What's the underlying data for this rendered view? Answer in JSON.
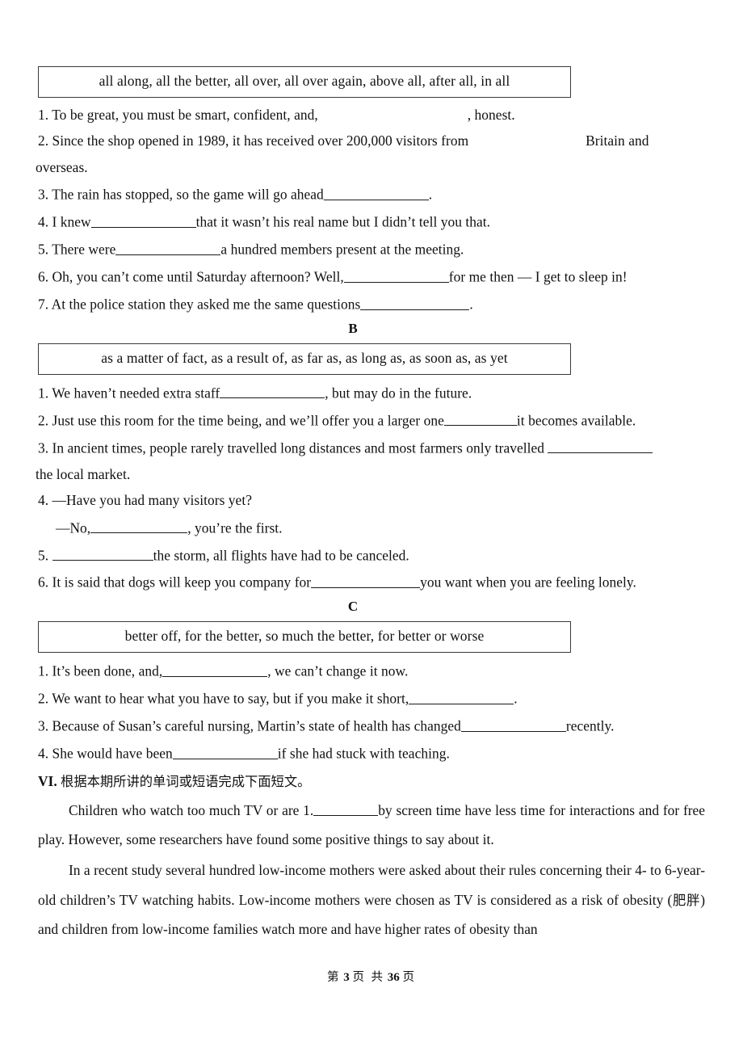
{
  "document": {
    "footer": {
      "prefix": "第",
      "page_number": "3",
      "middle": "页 共",
      "total_pages": "36",
      "suffix": "页"
    }
  },
  "sections": {
    "a": {
      "wordbank": "all along, all the better, all over, all over again, above all, after all, in all",
      "items": {
        "i1_pre": "1. To be great, you must be smart, confident, and,",
        "i1_post": ", honest.",
        "i2_pre": "2. Since the shop opened in 1989, it has received over 200,000 visitors from",
        "i2_post": "Britain and",
        "i2_cont": "overseas.",
        "i3_pre": "3. The rain has stopped, so the game will go ahead",
        "i3_post": ".",
        "i4_pre": "4. I knew",
        "i4_post": "that it wasn’t his real name but I didn’t tell you that.",
        "i5_pre": "5. There were",
        "i5_post": "a hundred members present at the meeting.",
        "i6_pre": "6. Oh, you can’t come until Saturday afternoon? Well,",
        "i6_post": "for me then — I get to sleep in!",
        "i7_pre": "7. At the police station they asked me the same questions",
        "i7_post": "."
      }
    },
    "b": {
      "letter": "B",
      "wordbank": "as a matter of fact, as a result of, as far as, as long as, as soon as, as yet",
      "items": {
        "i1_pre": "1. We haven’t needed extra staff",
        "i1_post": ", but may do in the future.",
        "i2_pre": "2. Just use this room for the time being, and we’ll offer you a larger one",
        "i2_post": "it becomes available.",
        "i3_pre": "3. In ancient times, people rarely travelled long distances and most farmers only travelled",
        "i3_cont": "the local market.",
        "i4_pre": "4. —Have you had many visitors yet?",
        "i4_sub_pre": "—No,",
        "i4_sub_post": ", you’re the first.",
        "i5_pre": "5.",
        "i5_post": "the storm, all flights have had to be canceled.",
        "i6_pre": "6. It is said that dogs will keep you company for",
        "i6_post": "you want when you are feeling lonely."
      }
    },
    "c": {
      "letter": "C",
      "wordbank": "better off, for the better, so much the better, for better or worse",
      "items": {
        "i1_pre": "1. It’s been done, and,",
        "i1_post": ", we can’t change it now.",
        "i2_pre": "2. We want to hear what you have to say, but if you make it short,",
        "i2_post": ".",
        "i3_pre": "3. Because of Susan’s careful nursing, Martin’s state of health has changed",
        "i3_post": "recently.",
        "i4_pre": "4. She would have been",
        "i4_post": "if she had stuck with teaching."
      }
    },
    "six": {
      "roman": "VI.",
      "instruction": "根据本期所讲的单词或短语完成下面短文。",
      "p1_pre": "Children who watch too much TV or  are 1.",
      "p1_post": "by screen time have less time for interactions and for free play. However, some researchers have found some positive things to say about it.",
      "p2_a": "In a recent study several hundred low-income mothers were asked about their rules concerning their 4- to 6-year-old children’s TV watching habits. Low-income mothers were chosen as TV is considered as a risk of obesity (",
      "p2_cn": "肥胖",
      "p2_b": ") and children from low-income families watch more and have higher rates of obesity than"
    }
  }
}
